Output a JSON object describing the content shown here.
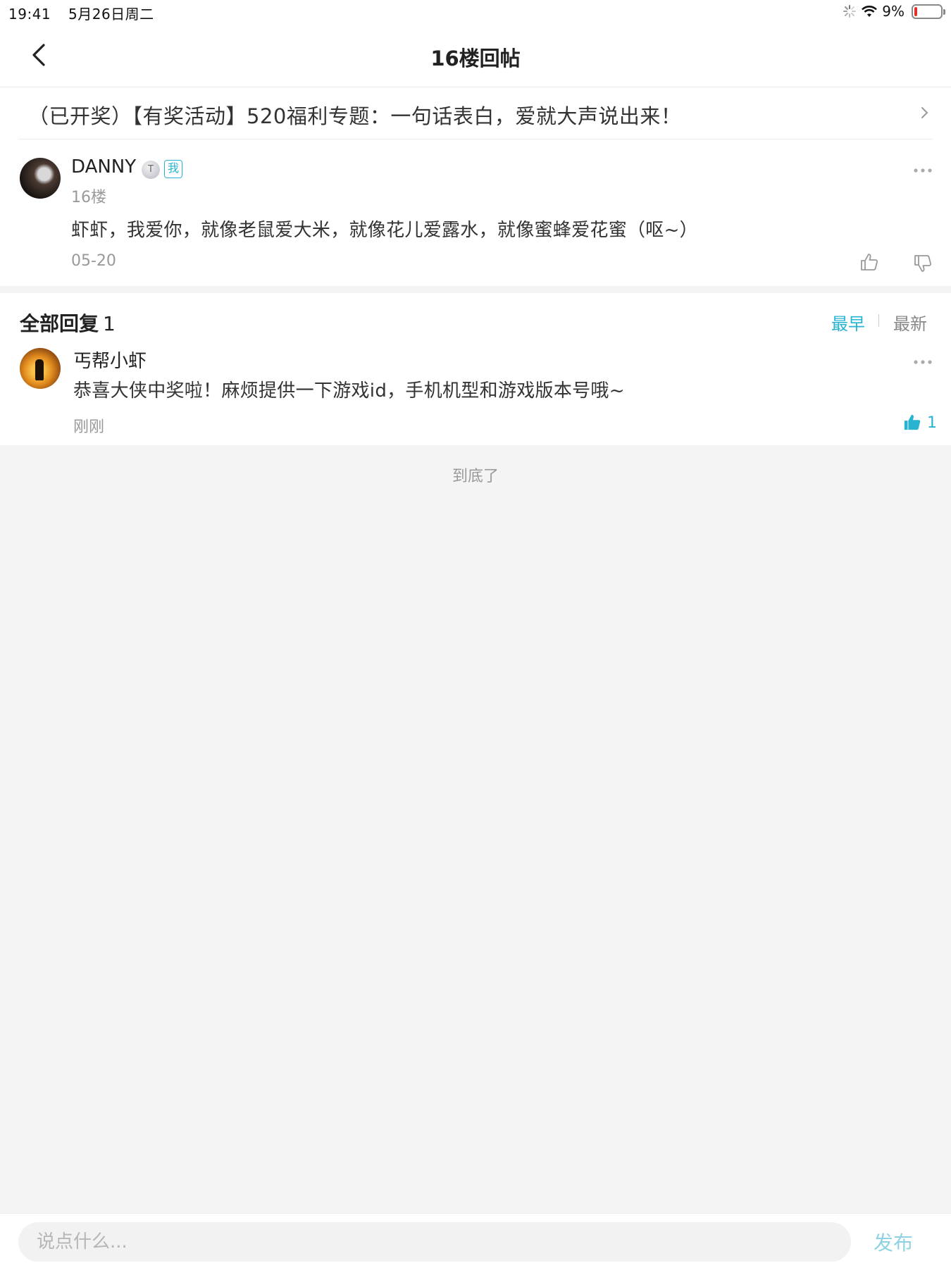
{
  "status_bar": {
    "time": "19:41",
    "date": "5月26日周二",
    "battery": "9%",
    "battery_level": 0.09
  },
  "nav": {
    "title": "16楼回帖",
    "back_icon": "chevron-left-icon"
  },
  "topic": {
    "text": "（已开奖）【有奖活动】520福利专题：一句话表白，爱就大声说出来！"
  },
  "post": {
    "author": "DANNY",
    "level_badge": "T",
    "me_badge": "我",
    "floor": "16楼",
    "body": "虾虾，我爱你，就像老鼠爱大米，就像花儿爱露水，就像蜜蜂爱花蜜（呕~）",
    "date": "05-20"
  },
  "replies": {
    "header": "全部回复",
    "count": "1",
    "sort_earliest": "最早",
    "sort_newest": "最新",
    "items": [
      {
        "author": "丐帮小虾",
        "body": "恭喜大侠中奖啦！麻烦提供一下游戏id，手机机型和游戏版本号哦~",
        "time": "刚刚",
        "likes": "1"
      }
    ]
  },
  "end_text": "到底了",
  "bottom": {
    "placeholder": "说点什么...",
    "publish": "发布"
  },
  "colors": {
    "accent": "#28b3d1",
    "publish_disabled": "#8fd3e3",
    "battery_low": "#e5302a"
  }
}
